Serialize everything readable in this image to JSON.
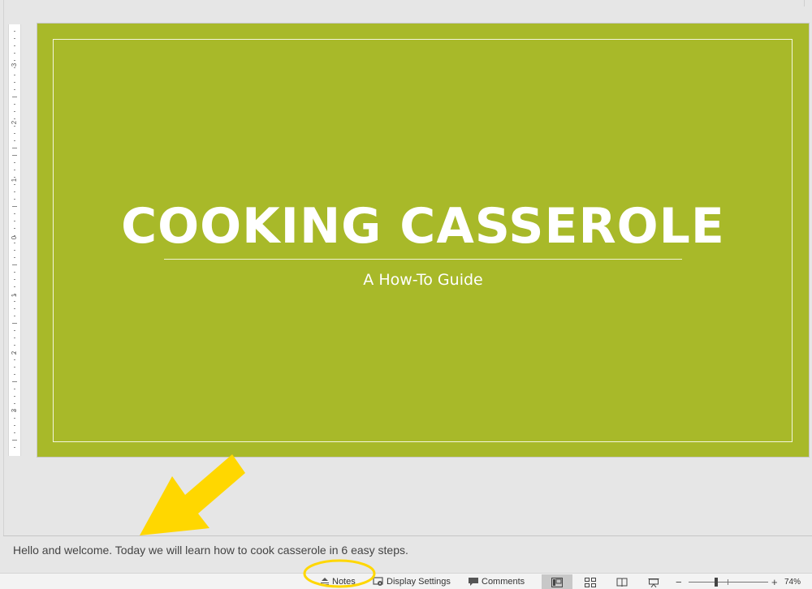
{
  "slide": {
    "title": "COOKING CASSEROLE",
    "subtitle": "A How-To Guide",
    "background_color": "#a8b929"
  },
  "ruler": {
    "labels": [
      "3",
      "2",
      "1",
      "0",
      "1",
      "2",
      "3"
    ]
  },
  "notes": {
    "text": "Hello and welcome. Today we will learn how to cook casserole in 6 easy steps."
  },
  "annotations": {
    "arrow_color": "#ffd700",
    "circle_color": "#ffd700"
  },
  "statusbar": {
    "notes_label": "Notes",
    "display_settings_label": "Display Settings",
    "comments_label": "Comments",
    "views": [
      "normal-view",
      "slide-sorter-view",
      "reading-view",
      "slide-show-view"
    ],
    "active_view": "normal-view",
    "zoom_minus": "−",
    "zoom_plus": "+",
    "zoom_level": "74%"
  }
}
